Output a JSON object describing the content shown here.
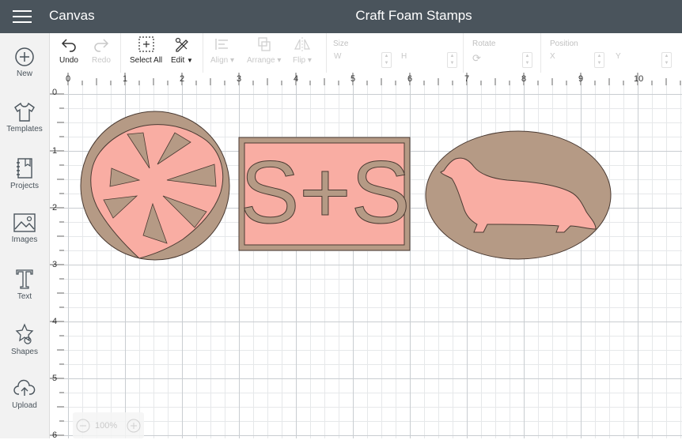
{
  "header": {
    "app_title": "Canvas",
    "doc_title": "Craft Foam Stamps",
    "bg_color": "#4a545c"
  },
  "sidebar": {
    "items": [
      {
        "label": "New",
        "icon": "plus-circle-icon"
      },
      {
        "label": "Templates",
        "icon": "tshirt-icon"
      },
      {
        "label": "Projects",
        "icon": "notebook-icon"
      },
      {
        "label": "Images",
        "icon": "image-icon"
      },
      {
        "label": "Text",
        "icon": "text-t-icon"
      },
      {
        "label": "Shapes",
        "icon": "shapes-icon"
      },
      {
        "label": "Upload",
        "icon": "cloud-upload-icon"
      }
    ]
  },
  "toolbar": {
    "undo": "Undo",
    "redo": "Redo",
    "select_all": "Select All",
    "edit": "Edit",
    "align": "Align",
    "arrange": "Arrange",
    "flip": "Flip",
    "size_label": "Size",
    "w_label": "W",
    "h_label": "H",
    "rotate_label": "Rotate",
    "position_label": "Position",
    "x_label": "X",
    "y_label": "Y"
  },
  "rulers": {
    "top": [
      "0",
      "1",
      "2",
      "3",
      "4",
      "5",
      "6",
      "7",
      "8",
      "9",
      "10"
    ],
    "left": [
      "0",
      "1",
      "2",
      "3",
      "4",
      "5",
      "6"
    ]
  },
  "canvas": {
    "shapes": [
      {
        "name": "monstera-leaf-stamp",
        "text": ""
      },
      {
        "name": "monogram-stamp",
        "text": "S+S"
      },
      {
        "name": "dachshund-stamp",
        "text": ""
      }
    ],
    "colors": {
      "foam_tan": "#b59a85",
      "foam_pink": "#f9ada3",
      "outline": "#4a3a32"
    }
  },
  "zoom": {
    "value": "100%"
  }
}
